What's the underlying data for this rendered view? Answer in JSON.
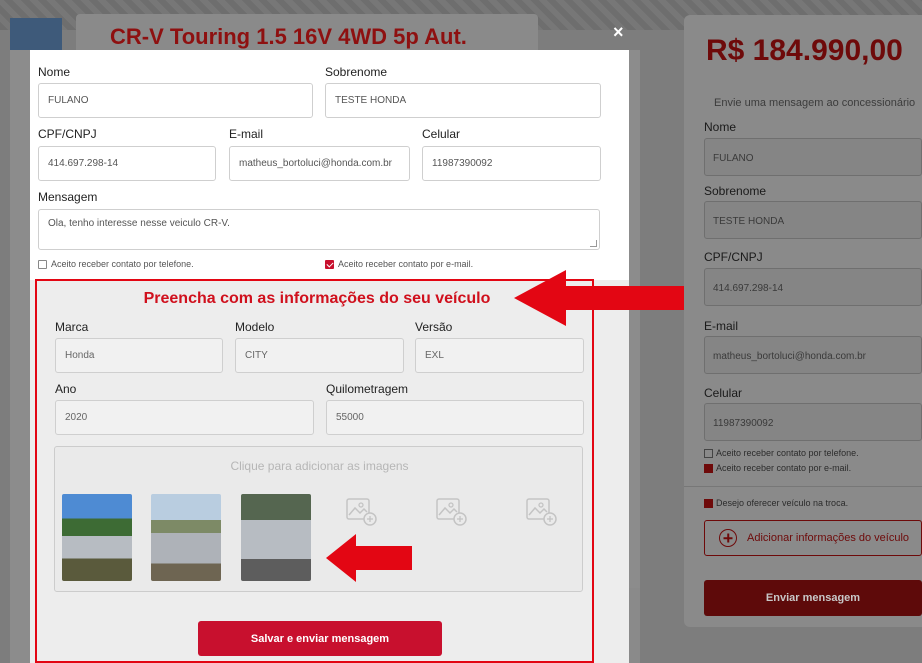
{
  "background": {
    "title": "CR-V Touring 1.5 16V 4WD 5p Aut.",
    "side_panel": {
      "price": "R$ 184.990,00",
      "subtitle": "Envie uma mensagem ao concessionário",
      "labels": [
        "Nome",
        "Sobrenome",
        "CPF/CNPJ",
        "E-mail",
        "Celular"
      ],
      "values": [
        "FULANO",
        "TESTE HONDA",
        "414.697.298-14",
        "matheus_bortoluci@honda.com.br",
        "11987390092"
      ],
      "check_phone": "Aceito receber contato por telefone.",
      "check_email": "Aceito receber contato por e-mail.",
      "check_trade": "Desejo oferecer veículo na troca.",
      "add_vehicle_label": "Adicionar informações do veículo",
      "send_label": "Enviar mensagem"
    }
  },
  "modal": {
    "close_glyph": "×",
    "fields": {
      "nome": {
        "label": "Nome",
        "value": "FULANO"
      },
      "sobrenome": {
        "label": "Sobrenome",
        "value": "TESTE HONDA"
      },
      "cpf": {
        "label": "CPF/CNPJ",
        "value": "414.697.298-14"
      },
      "email": {
        "label": "E-mail",
        "value": "matheus_bortoluci@honda.com.br"
      },
      "celular": {
        "label": "Celular",
        "value": "11987390092"
      },
      "mensagem": {
        "label": "Mensagem",
        "value": "Ola, tenho interesse nesse veiculo CR-V."
      }
    },
    "checkboxes": {
      "phone": {
        "label": "Aceito receber contato por telefone.",
        "checked": false
      },
      "email": {
        "label": "Aceito receber contato por e-mail.",
        "checked": true
      }
    },
    "vehicle_section": {
      "title": "Preencha com as informações do seu veículo",
      "marca": {
        "label": "Marca",
        "value": "Honda"
      },
      "modelo": {
        "label": "Modelo",
        "value": "CITY"
      },
      "versao": {
        "label": "Versão",
        "value": "EXL"
      },
      "ano": {
        "label": "Ano",
        "value": "2020"
      },
      "km": {
        "label": "Quilometragem",
        "value": "55000"
      },
      "upload_hint": "Clique para adicionar as imagens",
      "photos_count": 3,
      "empty_slots": 3
    },
    "save_label": "Salvar e enviar mensagem"
  },
  "colors": {
    "accent": "#c8102e",
    "annotation": "#e30613"
  }
}
